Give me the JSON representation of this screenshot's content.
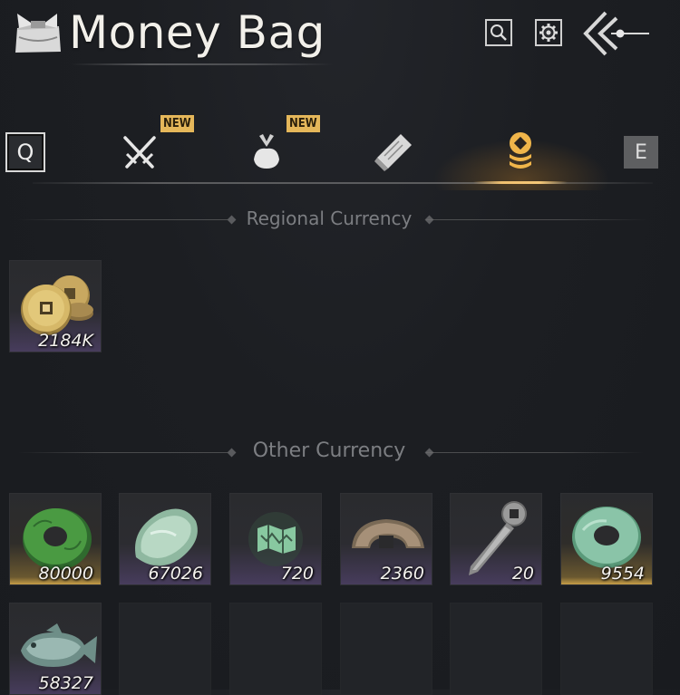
{
  "header": {
    "title": "Money Bag",
    "logo_icon": "money-bag-icon",
    "search_icon": "search-icon",
    "settings_icon": "gear-icon",
    "back_icon": "back-arrow-icon"
  },
  "tabs": {
    "prev_key": "Q",
    "next_key": "E",
    "items": [
      {
        "name": "weapons",
        "icon": "crossed-swords-icon",
        "badge": "NEW",
        "active": false
      },
      {
        "name": "bag",
        "icon": "bundle-icon",
        "badge": "NEW",
        "active": false
      },
      {
        "name": "scrolls",
        "icon": "scroll-icon",
        "badge": "",
        "active": false
      },
      {
        "name": "currency",
        "icon": "coin-stack-icon",
        "badge": "",
        "active": true
      }
    ],
    "active_color": "#f0c070"
  },
  "sections": {
    "regional": {
      "title": "Regional Currency",
      "items": [
        {
          "icon": "gold-coins-icon",
          "count": "2184K"
        }
      ]
    },
    "other": {
      "title": "Other Currency",
      "items": [
        {
          "icon": "green-jade-disc-icon",
          "count": "80000",
          "rarity": "gold"
        },
        {
          "icon": "pale-jade-stone-icon",
          "count": "67026",
          "rarity": "purple"
        },
        {
          "icon": "map-token-icon",
          "count": "720",
          "rarity": "purple"
        },
        {
          "icon": "half-coin-icon",
          "count": "2360",
          "rarity": "purple"
        },
        {
          "icon": "coin-sword-icon",
          "count": "20",
          "rarity": "purple"
        },
        {
          "icon": "jade-ring-icon",
          "count": "9554",
          "rarity": "gold"
        },
        {
          "icon": "jade-fish-icon",
          "count": "58327",
          "rarity": "purple"
        }
      ]
    }
  }
}
